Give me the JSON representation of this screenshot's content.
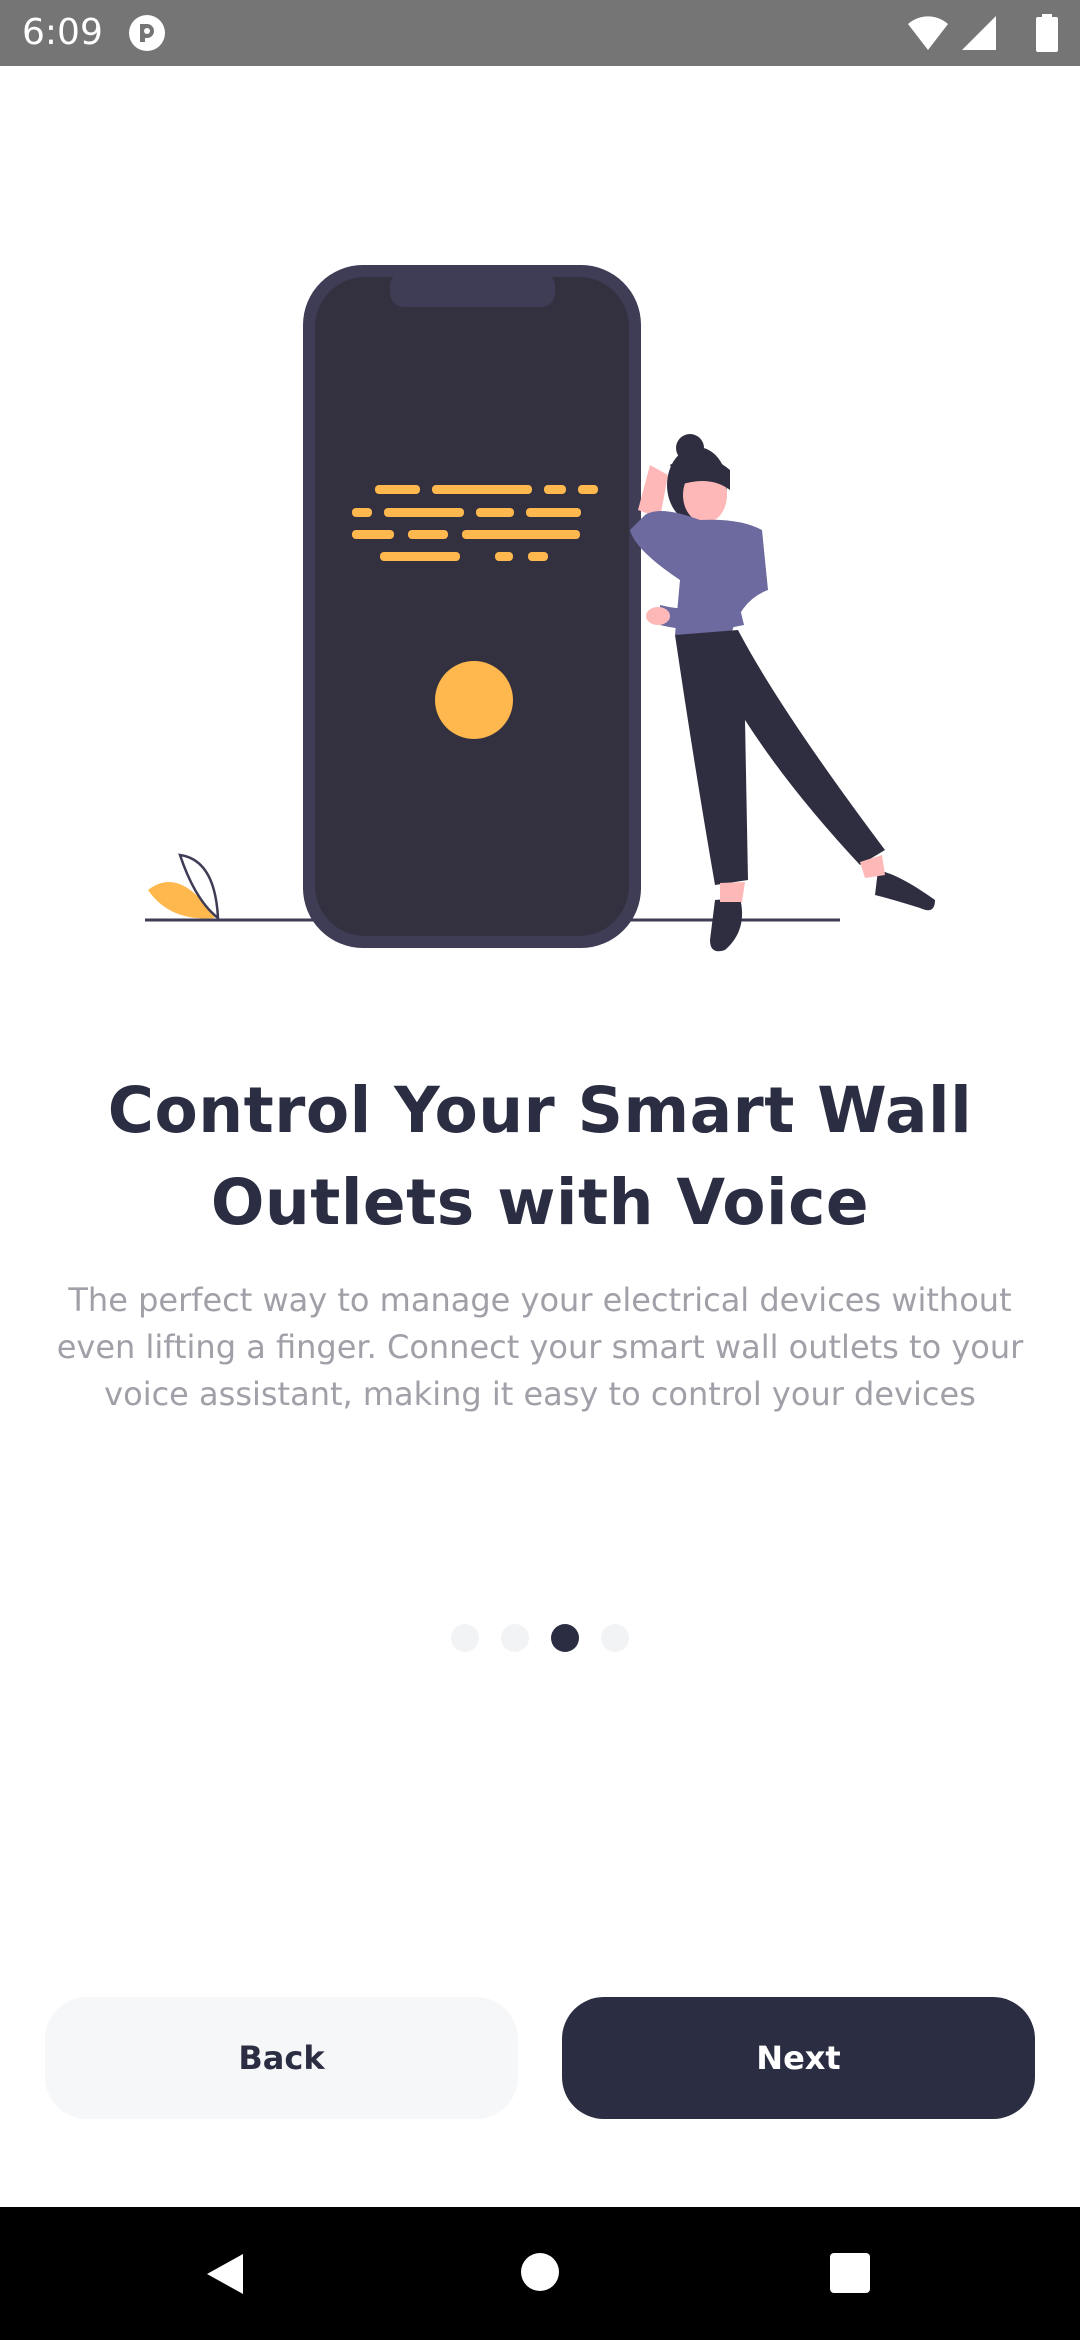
{
  "status_bar": {
    "time": "6:09"
  },
  "icons": {
    "app": "pocket-casts-style-app-icon",
    "wifi": "wifi-icon",
    "signal": "signal-icon",
    "battery": "battery-icon",
    "back": "nav-back-icon",
    "home": "nav-home-icon",
    "recents": "nav-recents-icon"
  },
  "onboarding": {
    "title_line1": "Control Your Smart Wall",
    "title_line2": "Outlets with Voice",
    "description_line1": "The perfect way to manage your electrical devices without",
    "description_line2": "even lifting a finger. Connect your smart wall outlets to your",
    "description_line3": "voice assistant, making it easy to control your devices",
    "page_count": 4,
    "current_page": 3
  },
  "buttons": {
    "back_label": "Back",
    "next_label": "Next"
  },
  "colors": {
    "primary": "#2b2d42",
    "accent": "#ffb84d",
    "figure_shirt": "#6c6a9e",
    "muted_text": "#a0a0a8",
    "back_button_bg": "#f6f7f9"
  }
}
